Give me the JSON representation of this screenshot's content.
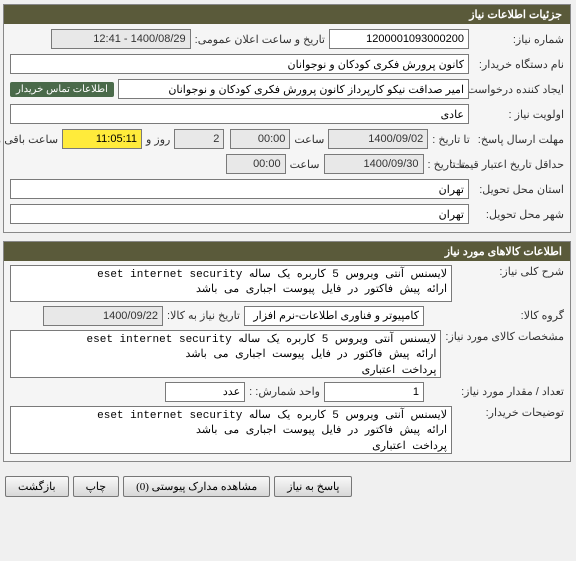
{
  "panel1": {
    "title": "جزئیات اطلاعات نیاز",
    "request_no_label": "شماره نیاز:",
    "request_no": "1200001093000200",
    "public_date_label": "تاریخ و ساعت اعلان عمومی:",
    "public_date": "1400/08/29 - 12:41",
    "org_label": "نام دستگاه خریدار:",
    "org": "کانون پرورش فکری کودکان و نوجوانان",
    "creator_label": "ایجاد کننده درخواست:",
    "creator": "امیر صداقت نیکو کارپرداز کانون پرورش فکری کودکان و نوجوانان",
    "contact_link": "اطلاعات تماس خریدار",
    "priority_label": "اولویت نیاز :",
    "priority": "عادی",
    "deadline_label": "مهلت ارسال پاسخ:",
    "to_date_label": "تا تاریخ :",
    "deadline_date": "1400/09/02",
    "time_label": "ساعت",
    "deadline_time": "00:00",
    "days_remain": "2",
    "days_remain_label": "روز و",
    "hours_remain": "11:05:11",
    "hours_remain_label": "ساعت باقی مانده",
    "validity_label": "حداقل تاریخ اعتبار قیمت:",
    "validity_date": "1400/09/30",
    "validity_time": "00:00",
    "province_label": "استان محل تحویل:",
    "province": "تهران",
    "city_label": "شهر محل تحویل:",
    "city": "تهران"
  },
  "panel2": {
    "title": "اطلاعات کالاهای مورد نیاز",
    "summary_label": "شرح کلی نیاز:",
    "summary": "لایسنس آنتی ویروس 5 کاربره یک ساله eset internet security\nارائه پیش فاکتور در فایل پیوست اجباری می باشد",
    "group_label": "گروه کالا:",
    "group": "کامپیوتر و فناوری اطلاعات-نرم افزار",
    "need_date_label": "تاریخ نیاز به کالا:",
    "need_date": "1400/09/22",
    "spec_label": "مشخصات کالای مورد نیاز:",
    "spec": "لایسنس آنتی ویروس 5 کاربره یک ساله eset internet security\nارائه پیش فاکتور در فایل پیوست اجباری می باشد\nپرداخت اعتباری",
    "qty_label": "تعداد / مقدار مورد نیاز:",
    "qty": "1",
    "unit_label": "واحد شمارش: :",
    "unit": "عدد",
    "notes_label": "توضیحات خریدار:",
    "notes": "لایسنس آنتی ویروس 5 کاربره یک ساله eset internet security\nارائه پیش فاکتور در فایل پیوست اجباری می باشد\nپرداخت اعتباری"
  },
  "buttons": {
    "reply": "پاسخ به نیاز",
    "attachments": "مشاهده مدارک پیوستی (0)",
    "print": "چاپ",
    "back": "بازگشت"
  }
}
